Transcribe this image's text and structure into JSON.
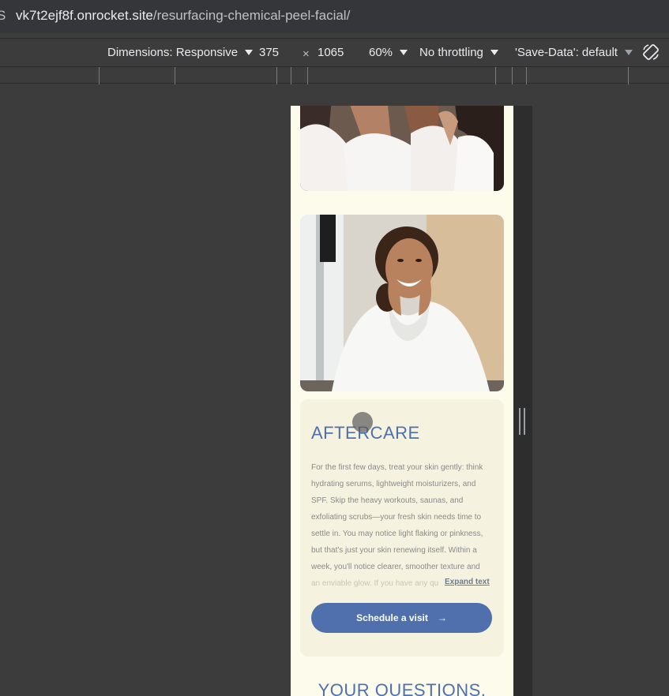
{
  "browser": {
    "url_lead": "S",
    "url_host": "vk7t2ejf8f.onrocket.site",
    "url_path": "/resurfacing-chemical-peel-facial/"
  },
  "devtools": {
    "dimensions_label": "Dimensions: Responsive",
    "width": "375",
    "times": "×",
    "height": "1065",
    "zoom": "60%",
    "throttling": "No throttling",
    "save_data": "'Save-Data': default"
  },
  "page": {
    "aftercare": {
      "title": "AFTERCARE",
      "lines": [
        "For the first few days, treat your skin gently: think",
        "hydrating serums, lightweight moisturizers, and",
        "SPF. Skip the heavy workouts, saunas, and",
        "exfoliating scrubs—your fresh skin needs time to",
        "settle in. You may notice light flaking or pinkness,",
        "but that's just your skin renewing itself. Within a",
        "week, you'll notice clearer, smoother texture and"
      ],
      "fade_line": "an enviable glow. If you have any qu",
      "expand_label": "Expand text",
      "cta_label": "Schedule a visit",
      "cta_arrow": "→"
    },
    "next_heading": "YOUR QUESTIONS,"
  },
  "colors": {
    "accent": "#4f70ad",
    "page_bg": "#fdfbec",
    "card_bg": "#f5f2df"
  },
  "icons": {
    "rotate": "rotate-device-icon",
    "arrow": "arrow-right-icon"
  }
}
